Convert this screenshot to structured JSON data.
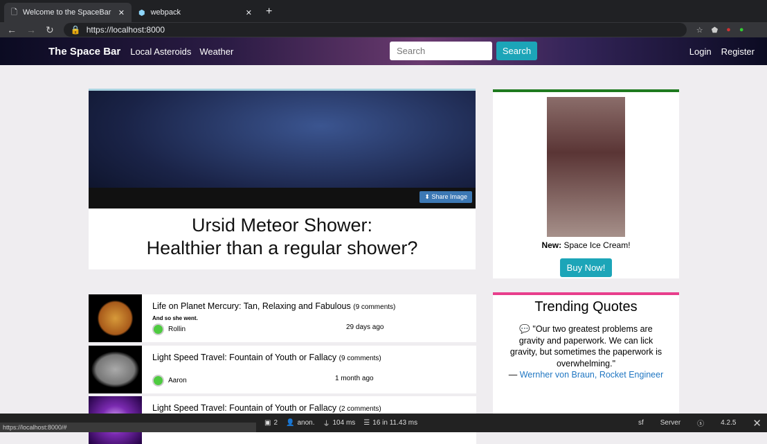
{
  "browser": {
    "tabs": [
      {
        "label": "Welcome to the SpaceBar",
        "active": true
      },
      {
        "label": "webpack",
        "active": false
      }
    ],
    "url": "https://localhost:8000",
    "status_url": "https://localhost:8000/#"
  },
  "nav": {
    "brand": "The Space Bar",
    "links": [
      "Local Asteroids",
      "Weather"
    ],
    "search_placeholder": "Search",
    "search_button": "Search",
    "login": "Login",
    "register": "Register"
  },
  "hero": {
    "share_label": "Share Image",
    "title_line1": "Ursid Meteor Shower:",
    "title_line2": "Healthier than a regular shower?"
  },
  "ad": {
    "label_bold": "New:",
    "label": "Space Ice Cream!",
    "button": "Buy Now!"
  },
  "quotes": {
    "title": "Trending Quotes",
    "text": "\"Our two greatest problems are gravity and paperwork. We can lick gravity, but sometimes the paperwork is overwhelming.\"",
    "author": "Wernher von Braun, Rocket Engineer"
  },
  "articles": [
    {
      "title": "Life on Planet Mercury: Tan, Relaxing and Fabulous",
      "comments": "(9 comments)",
      "subtitle": "And so she went.",
      "author": "Rollin",
      "ago": "29 days ago"
    },
    {
      "title": "Light Speed Travel: Fountain of Youth or Fallacy",
      "comments": "(9 comments)",
      "subtitle": "",
      "author": "Aaron",
      "ago": "1 month ago"
    },
    {
      "title": "Light Speed Travel: Fountain of Youth or Fallacy",
      "comments": "(2 comments)"
    }
  ],
  "toolbar": {
    "forms": "2",
    "user": "anon.",
    "time": "104 ms",
    "db": "16 in 11.43 ms",
    "server": "Server",
    "version": "4.2.5"
  }
}
